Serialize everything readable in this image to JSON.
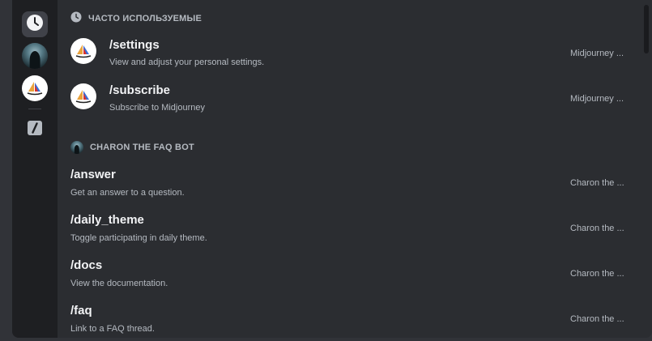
{
  "rail": {
    "items": [
      {
        "icon": "clock-icon"
      },
      {
        "icon": "charon-avatar"
      },
      {
        "icon": "midjourney-avatar"
      },
      {
        "icon": "slash-command-icon"
      }
    ]
  },
  "frequent": {
    "header": "ЧАСТО ИСПОЛЬЗУЕМЫЕ",
    "items": [
      {
        "name": "/settings",
        "description": "View and adjust your personal settings.",
        "source": "Midjourney ..."
      },
      {
        "name": "/subscribe",
        "description": "Subscribe to Midjourney",
        "source": "Midjourney ..."
      }
    ]
  },
  "charon": {
    "header": "CHARON THE FAQ BOT",
    "items": [
      {
        "name": "/answer",
        "description": "Get an answer to a question.",
        "source": "Charon the ..."
      },
      {
        "name": "/daily_theme",
        "description": "Toggle participating in daily theme.",
        "source": "Charon the ..."
      },
      {
        "name": "/docs",
        "description": "View the documentation.",
        "source": "Charon the ..."
      },
      {
        "name": "/faq",
        "description": "Link to a FAQ thread.",
        "source": "Charon the ..."
      }
    ]
  },
  "colors": {
    "background": "#2b2d31",
    "rail": "#1e1f22",
    "text_primary": "#f2f3f5",
    "text_secondary": "#b5bac1"
  }
}
